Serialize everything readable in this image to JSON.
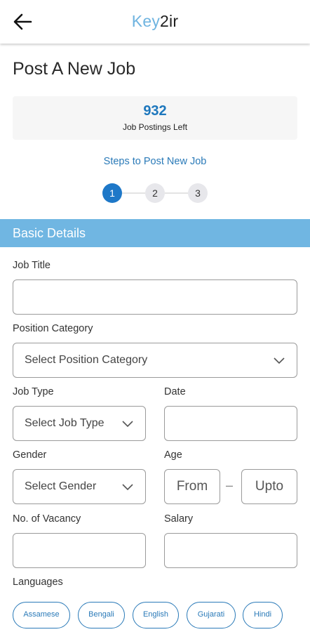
{
  "header": {
    "logo_part1": "Key",
    "logo_part2": "2ir",
    "back_icon": "arrow-left-icon"
  },
  "page_title": "Post A New Job",
  "quota": {
    "count": "932",
    "label": "Job Postings Left"
  },
  "steps": {
    "title": "Steps to Post New Job",
    "items": [
      "1",
      "2",
      "3"
    ],
    "active": 1
  },
  "section_title": "Basic Details",
  "form": {
    "job_title": {
      "label": "Job Title",
      "value": "",
      "placeholder": ""
    },
    "position_category": {
      "label": "Position Category",
      "placeholder": "Select Position Category"
    },
    "job_type": {
      "label": "Job Type",
      "placeholder": "Select Job Type"
    },
    "date": {
      "label": "Date",
      "value": ""
    },
    "gender": {
      "label": "Gender",
      "placeholder": "Select Gender"
    },
    "age": {
      "label": "Age",
      "from_placeholder": "From",
      "upto_placeholder": "Upto",
      "separator": "–"
    },
    "vacancy": {
      "label": "No. of Vacancy",
      "value": ""
    },
    "salary": {
      "label": "Salary",
      "value": ""
    },
    "languages": {
      "label": "Languages",
      "options": [
        "Assamese",
        "Bengali",
        "English",
        "Gujarati",
        "Hindi"
      ]
    }
  },
  "colors": {
    "accent": "#1e78c8",
    "section_bg": "#70b6e2",
    "link": "#2a7ab8",
    "logo_light": "#6fb4e0"
  }
}
